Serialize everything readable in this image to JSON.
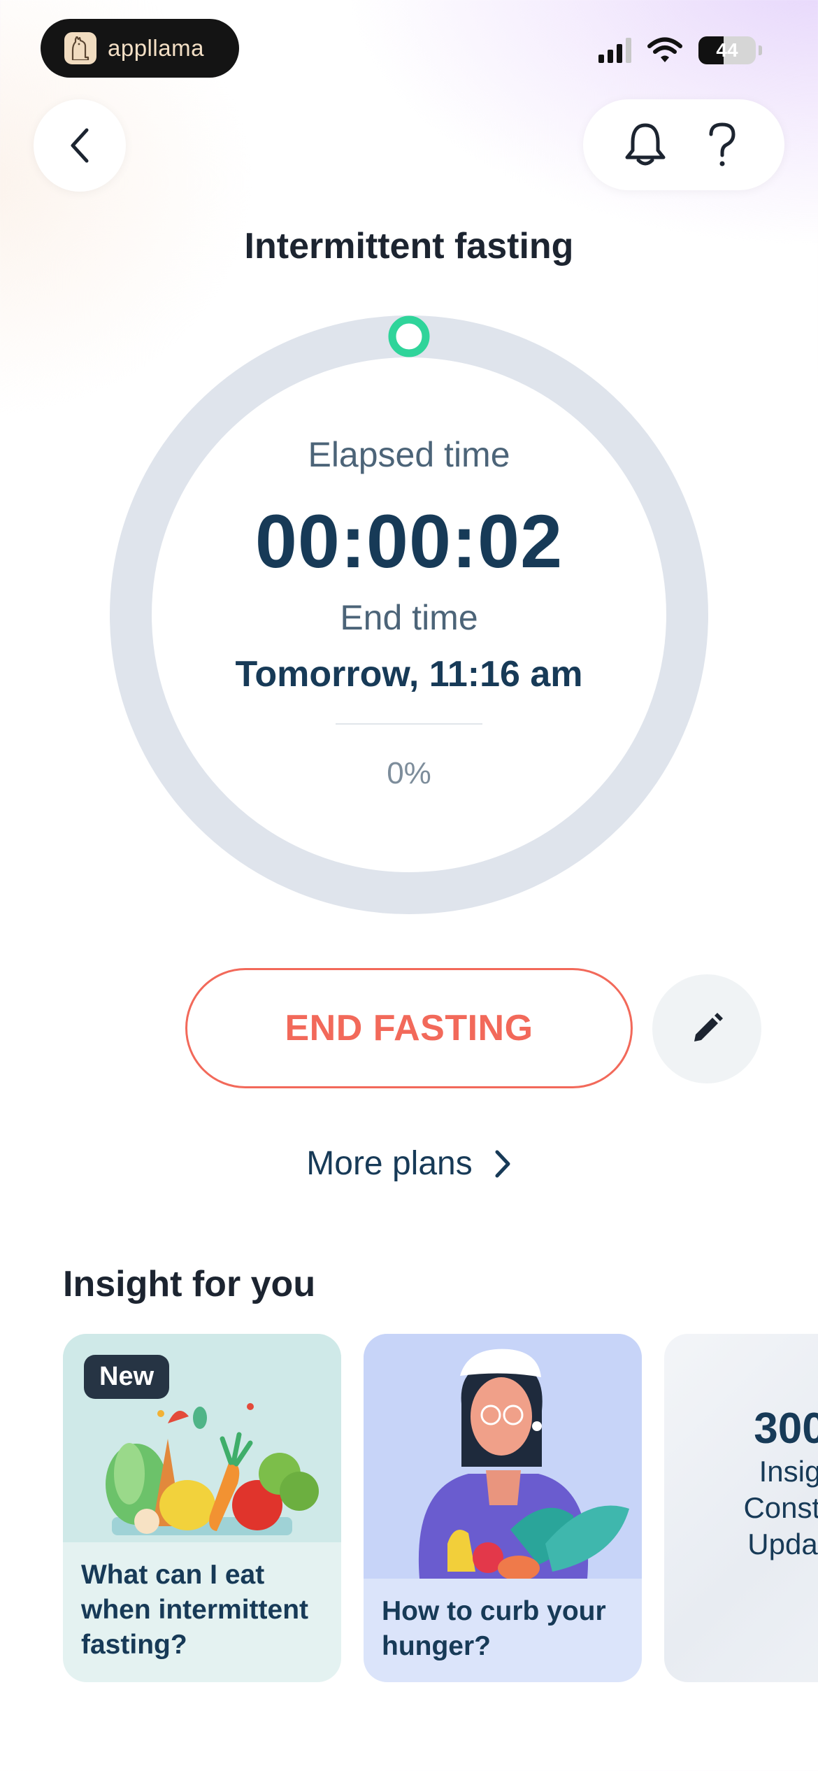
{
  "status_bar": {
    "brand": "appllama",
    "battery": "44",
    "battery_level": 0.44
  },
  "header": {
    "back_icon": "chevron-left-icon",
    "bell_icon": "bell-icon",
    "help_icon": "question-mark-icon",
    "title": "Intermittent fasting"
  },
  "timer": {
    "elapsed_label": "Elapsed time",
    "elapsed_value": "00:00:02",
    "end_label": "End time",
    "end_value": "Tomorrow, 11:16 am",
    "progress_text": "0%",
    "progress": 0,
    "ring_color": "#dfe4ec",
    "marker_color": "#2fd49a"
  },
  "actions": {
    "end_button": "END FASTING",
    "end_color": "#f2695a",
    "edit_icon": "pencil-icon",
    "more_plans": "More plans",
    "more_icon": "chevron-right-icon"
  },
  "insights": {
    "title": "Insight for you",
    "cards": [
      {
        "badge": "New",
        "text": "What can I eat when intermittent fasting?",
        "art": "vegetables-illustration"
      },
      {
        "text": "How to curb your hunger?",
        "art": "woman-with-vegetables-illustration"
      },
      {
        "number": "300",
        "lines": [
          "Insig",
          "Consta",
          "Updati"
        ]
      }
    ]
  }
}
